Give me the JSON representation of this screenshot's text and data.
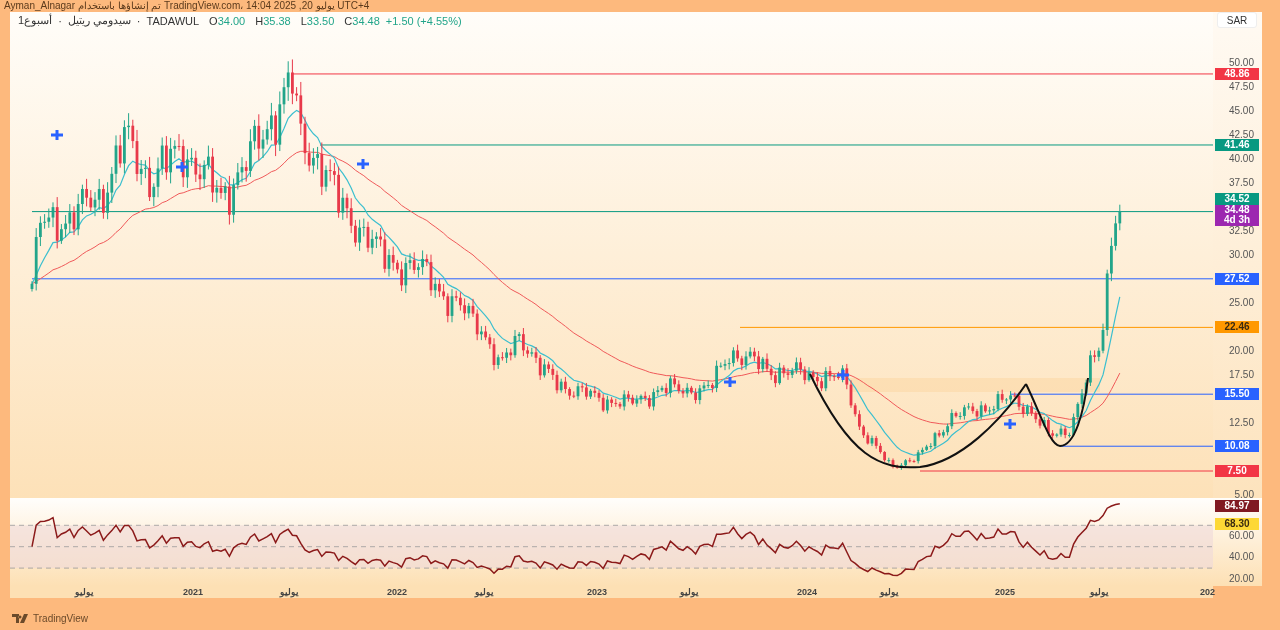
{
  "header": {
    "text": "Ayman_Alnagar تم إنشاؤها باستخدام TradingView.com، يوليو 20, 2025 14:04 UTC+4"
  },
  "legend": {
    "parts": [
      "1أسبوع",
      "·",
      "سيدومي ريتيل",
      "·",
      "TADAWUL"
    ],
    "ohlc": [
      {
        "label": "O",
        "value": "34.00"
      },
      {
        "label": "H",
        "value": "35.38"
      },
      {
        "label": "L",
        "value": "33.50"
      },
      {
        "label": "C",
        "value": "34.48"
      }
    ],
    "change": "+1.50 (+4.55%)"
  },
  "currency": "SAR",
  "price_axis": {
    "ticks": [
      "50.00",
      "47.50",
      "45.00",
      "42.50",
      "40.00",
      "37.50",
      "32.50",
      "30.00",
      "25.00",
      "20.00",
      "17.50",
      "12.50",
      "5.00"
    ]
  },
  "price_levels": [
    {
      "label": "48.86",
      "color": "#f23645"
    },
    {
      "label": "41.46",
      "color": "#089981"
    },
    {
      "label": "34.52",
      "color": "#089981"
    },
    {
      "label": "34.48",
      "sublabel": "4d 3h",
      "color": "#9c27b0"
    },
    {
      "label": "27.52",
      "color": "#2962ff"
    },
    {
      "label": "22.46",
      "color": "#ff9800"
    },
    {
      "label": "15.50",
      "color": "#2962ff"
    },
    {
      "label": "10.08",
      "color": "#2962ff"
    },
    {
      "label": "7.50",
      "color": "#f23645"
    }
  ],
  "rsi_axis": {
    "ticks": [
      "60.00",
      "40.00",
      "20.00"
    ]
  },
  "rsi_levels": [
    {
      "label": "84.97",
      "color": "#801922"
    },
    {
      "label": "68.30",
      "color": "#fdd835"
    }
  ],
  "time_axis": [
    "يوليو",
    "2021",
    "يوليو",
    "2022",
    "يوليو",
    "2023",
    "يوليو",
    "2024",
    "يوليو",
    "2025",
    "يوليو",
    "202"
  ],
  "footer": {
    "brand": "TradingView"
  }
}
